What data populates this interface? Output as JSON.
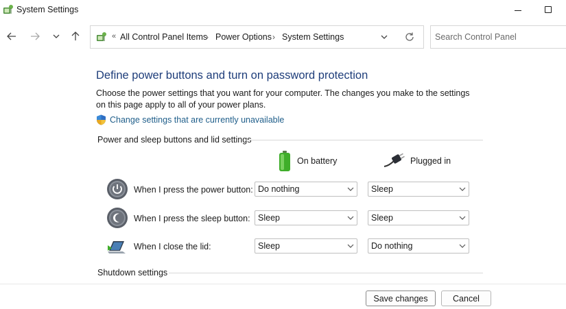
{
  "window": {
    "title": "System Settings",
    "app_icon": "control-panel-icon"
  },
  "nav": {
    "back_icon": "arrow-left-icon",
    "forward_icon": "arrow-right-icon",
    "recent_icon": "chevron-down-icon",
    "up_icon": "arrow-up-icon",
    "breadcrumb_overflow": "«",
    "breadcrumbs": [
      "All Control Panel Items",
      "Power Options",
      "System Settings"
    ],
    "search_placeholder": "Search Control Panel"
  },
  "page": {
    "heading": "Define power buttons and turn on password protection",
    "description": "Choose the power settings that you want for your computer. The changes you make to the settings on this page apply to all of your power plans.",
    "admin_link": "Change settings that are currently unavailable"
  },
  "power_section": {
    "label": "Power and sleep buttons and lid settings",
    "columns": [
      {
        "label": "On battery",
        "icon": "battery-icon"
      },
      {
        "label": "Plugged in",
        "icon": "power-plug-icon"
      }
    ],
    "rows": [
      {
        "label": "When I press the power button:",
        "icon": "power-button-icon",
        "on_battery": "Do nothing",
        "plugged_in": "Sleep"
      },
      {
        "label": "When I press the sleep button:",
        "icon": "sleep-button-icon",
        "on_battery": "Sleep",
        "plugged_in": "Sleep"
      },
      {
        "label": "When I close the lid:",
        "icon": "laptop-lid-icon",
        "on_battery": "Sleep",
        "plugged_in": "Do nothing"
      }
    ]
  },
  "shutdown_section": {
    "label": "Shutdown settings"
  },
  "footer": {
    "save_label": "Save changes",
    "cancel_label": "Cancel"
  },
  "colors": {
    "heading": "#1e3d7a",
    "link": "#1f5e8a",
    "battery": "#3fae2a"
  }
}
